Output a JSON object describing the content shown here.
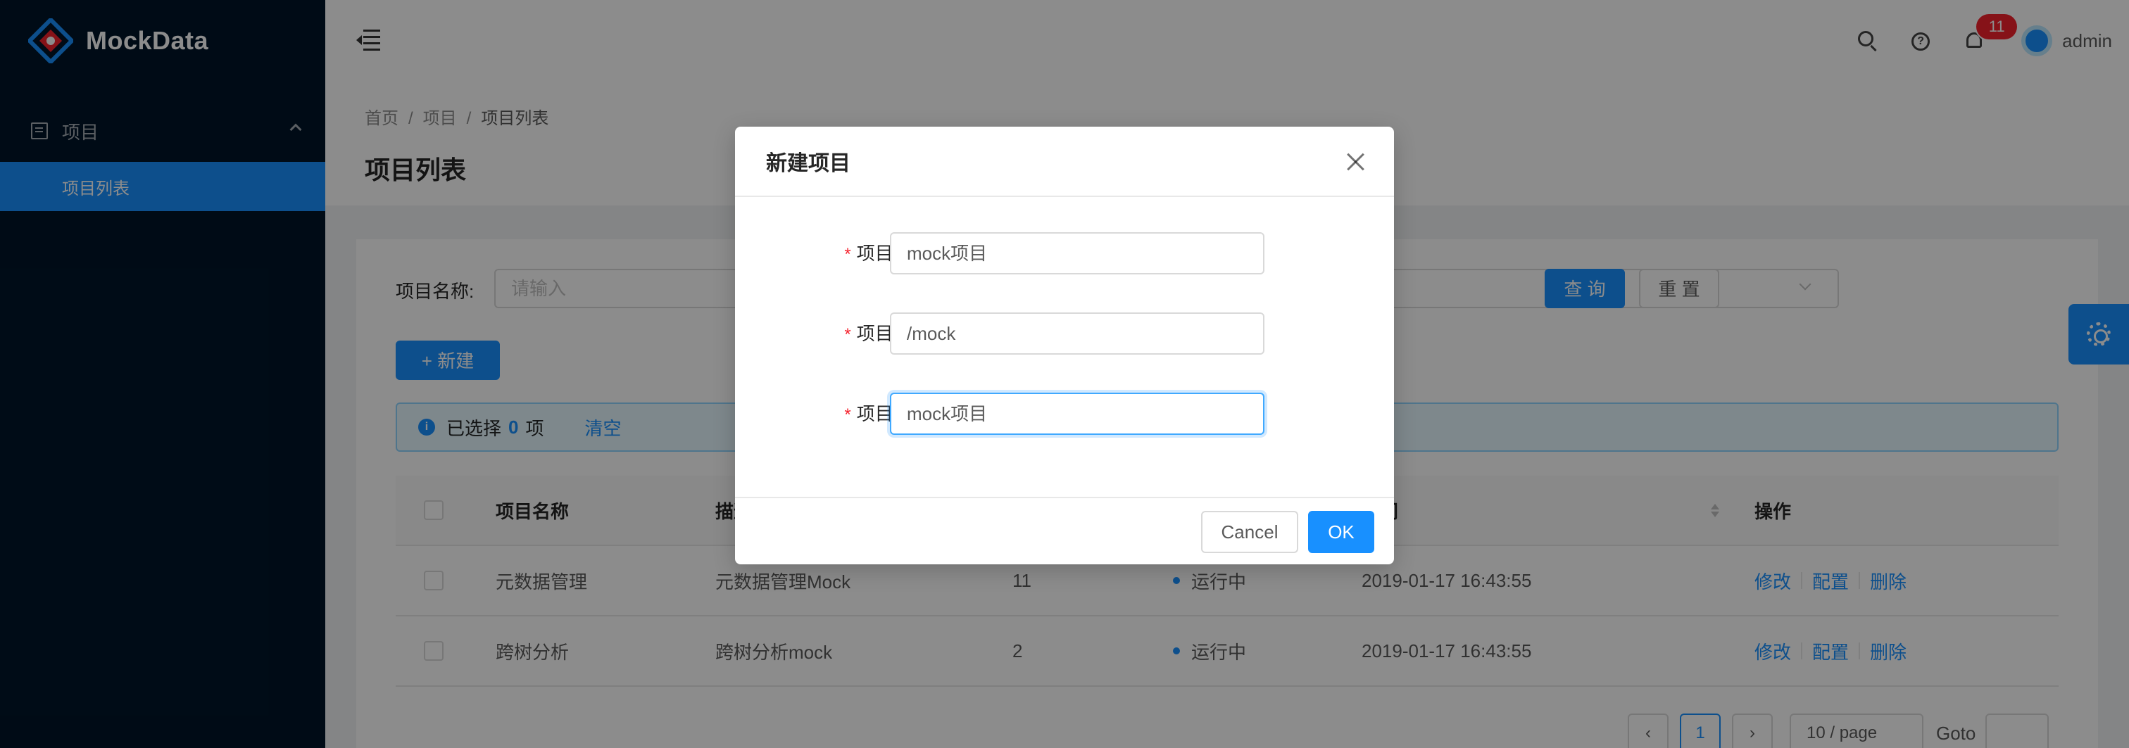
{
  "app": {
    "name": "MockData"
  },
  "sidebar": {
    "group_label": "项目",
    "items": [
      {
        "label": "项目列表"
      }
    ]
  },
  "header": {
    "notification_count": "11",
    "user_name": "admin"
  },
  "breadcrumb": [
    "首页",
    "项目",
    "项目列表"
  ],
  "page_title": "项目列表",
  "search_form": {
    "name_label": "项目名称:",
    "name_placeholder": "请输入",
    "query_label": "查 询",
    "reset_label": "重 置"
  },
  "toolbar": {
    "new_label": "+ 新建"
  },
  "selection_alert": {
    "prefix": "已选择",
    "count": "0",
    "suffix": "项",
    "clear_label": "清空"
  },
  "table": {
    "columns": [
      "项目名称",
      "描述",
      "",
      "",
      "时间",
      "操作"
    ],
    "rows": [
      {
        "name": "元数据管理",
        "desc": "元数据管理Mock",
        "count": "11",
        "status": "运行中",
        "time": "2019-01-17 16:43:55",
        "actions": [
          "修改",
          "配置",
          "删除"
        ]
      },
      {
        "name": "跨树分析",
        "desc": "跨树分析mock",
        "count": "2",
        "status": "运行中",
        "time": "2019-01-17 16:43:55",
        "actions": [
          "修改",
          "配置",
          "删除"
        ]
      }
    ]
  },
  "pagination": {
    "current": "1",
    "page_size": "10 / page",
    "goto_label": "Goto"
  },
  "modal": {
    "title": "新建项目",
    "fields": [
      {
        "label": "项目名称:",
        "value": "mock项目"
      },
      {
        "label": "项目目录:",
        "value": "/mock"
      },
      {
        "label": "项目描述:",
        "value": "mock项目"
      }
    ],
    "required_mark": "*",
    "cancel_label": "Cancel",
    "ok_label": "OK"
  },
  "colors": {
    "primary": "#1890ff",
    "sider_bg": "#001529",
    "danger": "#f5222d"
  }
}
